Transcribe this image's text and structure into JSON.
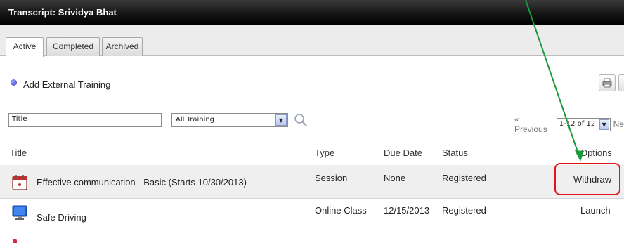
{
  "window": {
    "title": "Transcript: Srividya Bhat"
  },
  "tabs": [
    {
      "label": "Active",
      "selected": true
    },
    {
      "label": "Completed",
      "selected": false
    },
    {
      "label": "Archived",
      "selected": false
    }
  ],
  "actions": {
    "add_external_training": "Add External Training"
  },
  "filters": {
    "title_value": "Title",
    "training_type_value": "All Training"
  },
  "pager": {
    "previous_label": "« Previous",
    "range_value": "1-12 of 12",
    "next_label": "Ne"
  },
  "table": {
    "columns": [
      "Title",
      "Type",
      "Due Date",
      "Status",
      "Options"
    ],
    "rows": [
      {
        "icon": "calendar-session-icon",
        "title": "Effective communication - Basic (Starts 10/30/2013)",
        "type": "Session",
        "due_date": "None",
        "status": "Registered",
        "option": "Withdraw"
      },
      {
        "icon": "computer-monitor-icon",
        "title": "Safe Driving",
        "type": "Online Class",
        "due_date": "12/15/2013",
        "status": "Registered",
        "option": "Launch"
      }
    ]
  },
  "colors": {
    "title_bar": "#000000",
    "highlight": "#e0141b",
    "annotation_arrow": "#1a9a3a"
  }
}
